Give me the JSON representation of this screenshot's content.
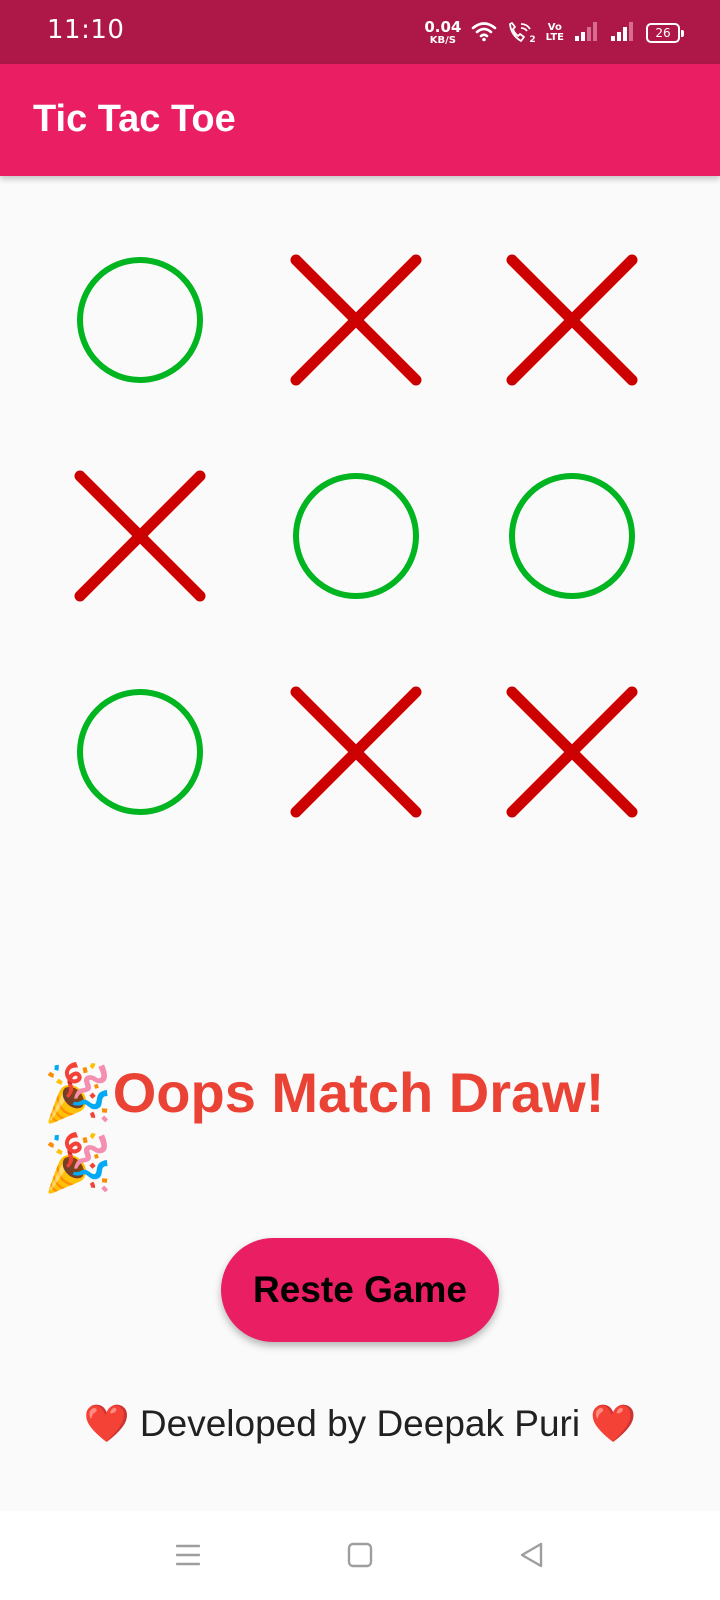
{
  "status_bar": {
    "time": "11:10",
    "net_speed_value": "0.04",
    "net_speed_unit": "KB/S",
    "volte_top": "Vo",
    "volte_bottom": "LTE",
    "sim_badge": "2",
    "battery": "26"
  },
  "app_bar": {
    "title": "Tic Tac Toe"
  },
  "board": {
    "cells": [
      "O",
      "X",
      "X",
      "X",
      "O",
      "O",
      "O",
      "X",
      "X"
    ],
    "x_color": "#cc0000",
    "o_color": "#00b520"
  },
  "result": {
    "text": "🎉Oops Match Draw!🎉",
    "color": "#ea4335"
  },
  "reset_button": {
    "label": "Reste Game"
  },
  "footer": {
    "text": "❤️ Developed by Deepak Puri ❤️"
  },
  "nav_bar": {
    "icons": [
      "menu-icon",
      "home-icon",
      "back-icon"
    ]
  }
}
